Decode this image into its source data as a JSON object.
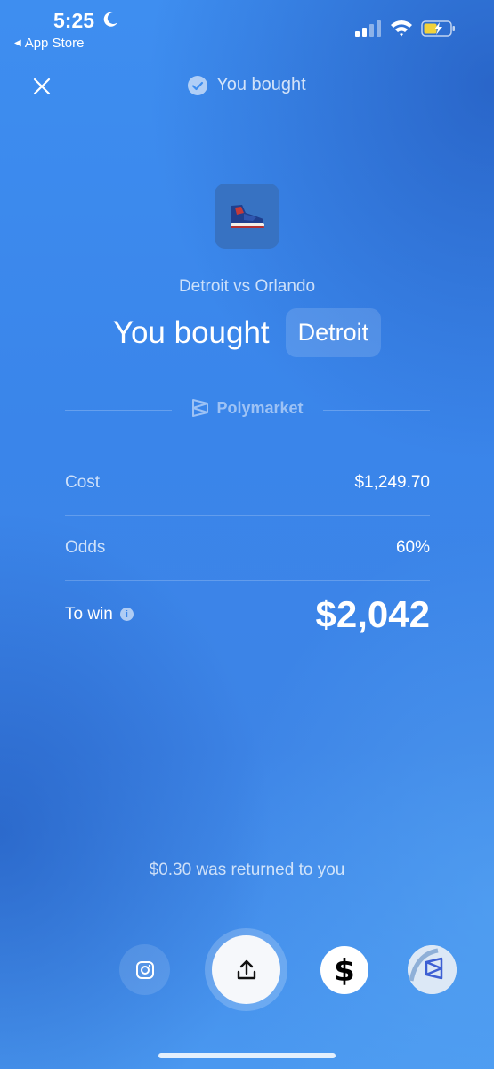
{
  "status_bar": {
    "time": "5:25",
    "back_label": "App Store"
  },
  "header": {
    "title": "You bought"
  },
  "product": {
    "icon": "sneaker-icon",
    "matchup": "Detroit vs Orlando",
    "headline": "You bought",
    "team": "Detroit"
  },
  "brand": {
    "name": "Polymarket"
  },
  "details": {
    "cost_label": "Cost",
    "cost_value": "$1,249.70",
    "odds_label": "Odds",
    "odds_value": "60%",
    "win_label": "To win",
    "win_value": "$2,042"
  },
  "footer": {
    "returned_text": "$0.30 was returned to you"
  },
  "share_icons": [
    "instagram-icon",
    "share-upload-icon",
    "cash-app-icon",
    "polymarket-icon"
  ],
  "colors": {
    "background": "#3e8ef0",
    "thumb_bg": "#3772c2"
  }
}
